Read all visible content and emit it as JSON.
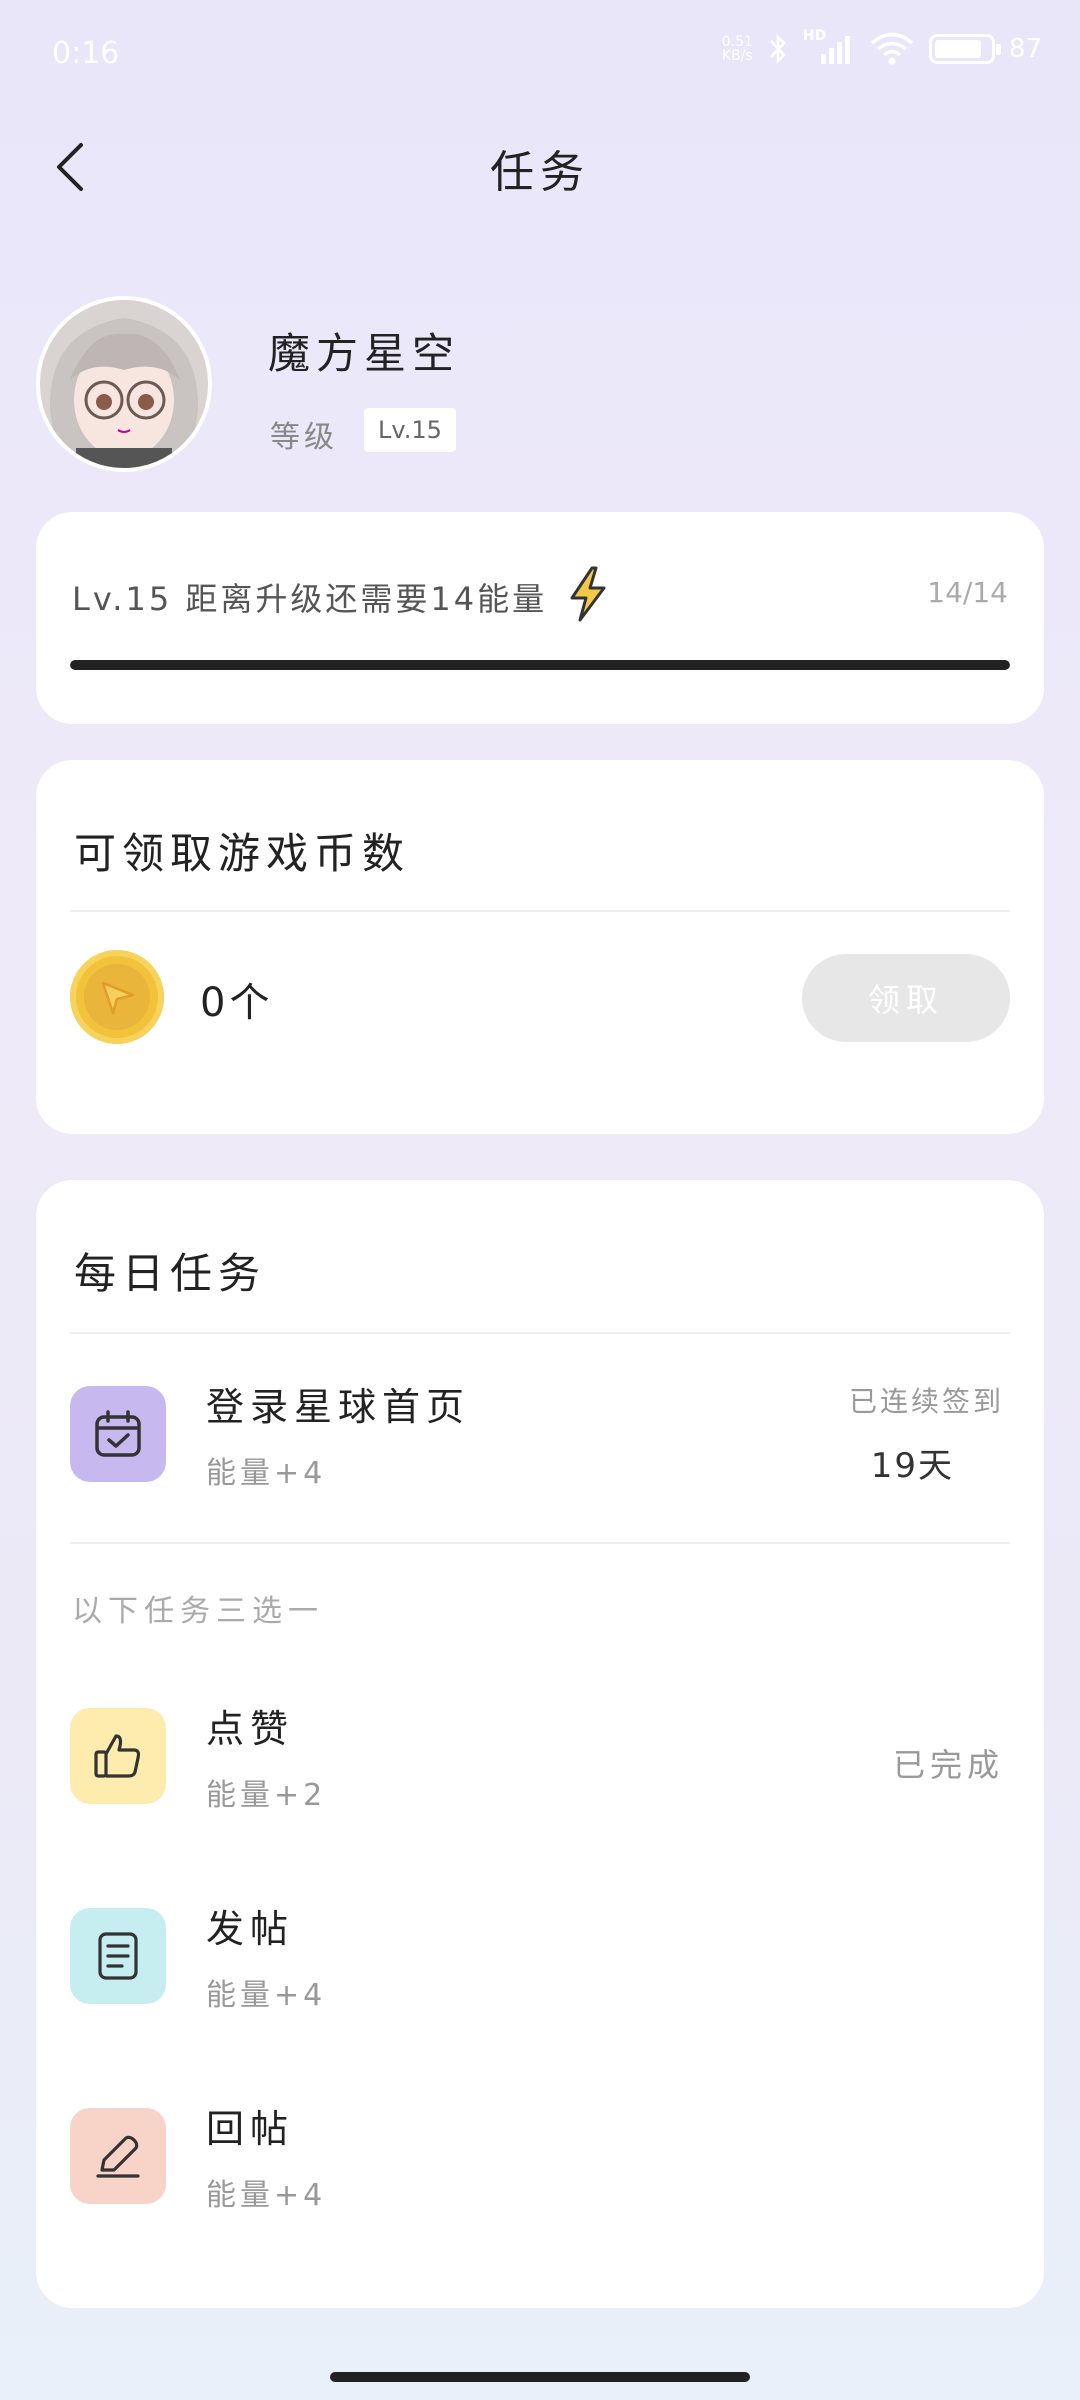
{
  "status_bar": {
    "time": "0:16",
    "net_speed_top": "0.51",
    "net_speed_bottom": "KB/s",
    "hd_label": "HD",
    "battery_level": 0.87,
    "battery_text": "87"
  },
  "header": {
    "title": "任务"
  },
  "profile": {
    "username": "魔方星空",
    "level_label": "等级",
    "level_badge": "Lv.15"
  },
  "level_card": {
    "text": "Lv.15 距离升级还需要14能量",
    "count": "14/14",
    "progress": 1.0
  },
  "coin_card": {
    "heading": "可领取游戏币数",
    "count": "0个",
    "claim_label": "领取"
  },
  "daily_tasks": {
    "heading": "每日任务",
    "login_task": {
      "title": "登录星球首页",
      "energy": "能量+4",
      "streak_label": "已连续签到",
      "streak_days": "19天"
    },
    "choose_note": "以下任务三选一",
    "tasks": [
      {
        "title": "点赞",
        "energy": "能量+2",
        "status": "已完成",
        "icon": "thumbs-up-icon",
        "color": "#fdecae"
      },
      {
        "title": "发帖",
        "energy": "能量+4",
        "status": "",
        "icon": "document-icon",
        "color": "#c6eef0"
      },
      {
        "title": "回帖",
        "energy": "能量+4",
        "status": "",
        "icon": "pen-icon",
        "color": "#f8d3c8"
      }
    ],
    "login_icon_color": "#c7b9ef"
  }
}
